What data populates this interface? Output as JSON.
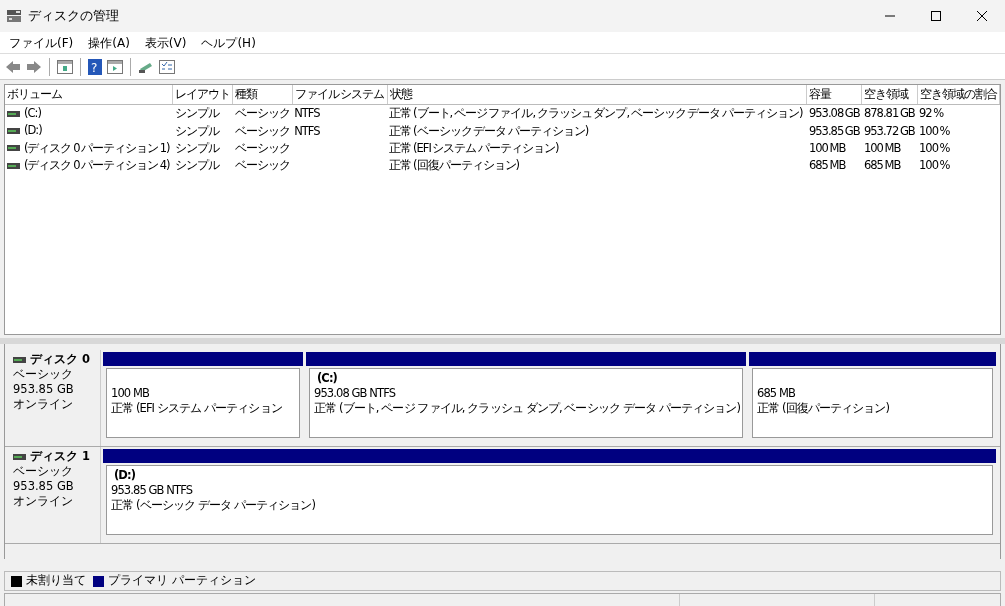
{
  "window": {
    "title": "ディスクの管理"
  },
  "help_glyph": "?",
  "menu": [
    "ファイル(F)",
    "操作(A)",
    "表示(V)",
    "ヘルプ(H)"
  ],
  "table": {
    "columns": [
      "ボリューム",
      "レイアウト",
      "種類",
      "ファイル システム",
      "状態",
      "容量",
      "空き領域",
      "空き領域の割合"
    ],
    "rows": [
      [
        "(C:)",
        "シンプル",
        "ベーシック",
        "NTFS",
        "正常 (ブート, ページ ファイル, クラッシュ ダンプ, ベーシック データ パーティション)",
        "953.08 GB",
        "878.81 GB",
        "92 %"
      ],
      [
        "(D:)",
        "シンプル",
        "ベーシック",
        "NTFS",
        "正常 (ベーシック データ パーティション)",
        "953.85 GB",
        "953.72 GB",
        "100 %"
      ],
      [
        "(ディスク 0 パーティション 1)",
        "シンプル",
        "ベーシック",
        "",
        "正常 (EFI システム パーティション)",
        "100 MB",
        "100 MB",
        "100 %"
      ],
      [
        "(ディスク 0 パーティション 4)",
        "シンプル",
        "ベーシック",
        "",
        "正常 (回復パーティション)",
        "685 MB",
        "685 MB",
        "100 %"
      ]
    ]
  },
  "disks": [
    {
      "name": "ディスク 0",
      "type": "ベーシック",
      "size": "953.85 GB",
      "status": "オンライン",
      "partitions": [
        {
          "kind": "primary",
          "size": "100 MB",
          "status": "正常 (EFI システム パーティション"
        },
        {
          "kind": "primary",
          "label": "(C:)",
          "size": "953.08 GB NTFS",
          "status": "正常 (ブート, ページ ファイル, クラッシュ ダンプ, ベーシック データ パーティション)"
        },
        {
          "kind": "primary",
          "size": "685 MB",
          "status": "正常 (回復パーティション)"
        }
      ]
    },
    {
      "name": "ディスク 1",
      "type": "ベーシック",
      "size": "953.85 GB",
      "status": "オンライン",
      "partitions": [
        {
          "kind": "primary",
          "label": "(D:)",
          "size": "953.85 GB NTFS",
          "status": "正常 (ベーシック データ パーティション)"
        }
      ]
    }
  ],
  "legend": [
    {
      "kind": "unallocated",
      "label": "未割り当て",
      "color": "#000000"
    },
    {
      "kind": "primary",
      "label": "プライマリ パーティション",
      "color": "#000080"
    }
  ]
}
